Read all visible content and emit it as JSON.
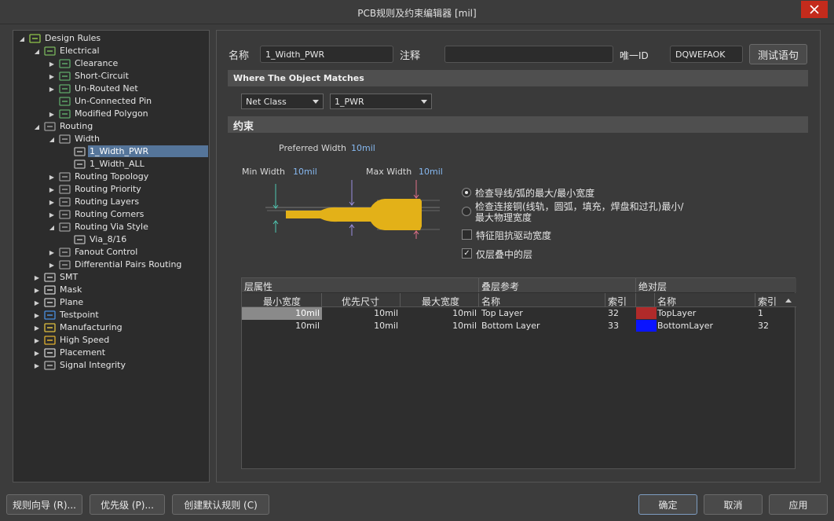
{
  "window": {
    "title": "PCB规则及约束编辑器 [mil]"
  },
  "tree": {
    "items": [
      {
        "label": "Design Rules",
        "icon": "design-rules-icon",
        "expand": "open"
      },
      {
        "label": "Electrical",
        "icon": "electrical-icon",
        "expand": "open"
      },
      {
        "label": "Clearance",
        "icon": "rule-icon",
        "expand": "closed"
      },
      {
        "label": "Short-Circuit",
        "icon": "rule-icon",
        "expand": "closed"
      },
      {
        "label": "Un-Routed Net",
        "icon": "rule-icon",
        "expand": "closed"
      },
      {
        "label": "Un-Connected Pin",
        "icon": "rule-icon",
        "expand": "none"
      },
      {
        "label": "Modified Polygon",
        "icon": "rule-icon",
        "expand": "closed"
      },
      {
        "label": "Routing",
        "icon": "routing-icon",
        "expand": "open"
      },
      {
        "label": "Width",
        "icon": "width-icon",
        "expand": "open"
      },
      {
        "label": "1_Width_PWR",
        "icon": "width-rule-icon",
        "expand": "none"
      },
      {
        "label": "1_Width_ALL",
        "icon": "width-rule-icon",
        "expand": "none"
      },
      {
        "label": "Routing Topology",
        "icon": "routing-icon",
        "expand": "closed"
      },
      {
        "label": "Routing Priority",
        "icon": "routing-icon",
        "expand": "closed"
      },
      {
        "label": "Routing Layers",
        "icon": "routing-icon",
        "expand": "closed"
      },
      {
        "label": "Routing Corners",
        "icon": "routing-icon",
        "expand": "closed"
      },
      {
        "label": "Routing Via Style",
        "icon": "routing-icon",
        "expand": "open"
      },
      {
        "label": "Via_8/16",
        "icon": "via-rule-icon",
        "expand": "none"
      },
      {
        "label": "Fanout Control",
        "icon": "routing-icon",
        "expand": "closed"
      },
      {
        "label": "Differential Pairs Routing",
        "icon": "routing-icon",
        "expand": "closed"
      },
      {
        "label": "SMT",
        "icon": "smt-icon",
        "expand": "closed"
      },
      {
        "label": "Mask",
        "icon": "mask-icon",
        "expand": "closed"
      },
      {
        "label": "Plane",
        "icon": "plane-icon",
        "expand": "closed"
      },
      {
        "label": "Testpoint",
        "icon": "testpoint-icon",
        "expand": "closed"
      },
      {
        "label": "Manufacturing",
        "icon": "manufacturing-icon",
        "expand": "closed"
      },
      {
        "label": "High Speed",
        "icon": "high-speed-icon",
        "expand": "closed"
      },
      {
        "label": "Placement",
        "icon": "placement-icon",
        "expand": "closed"
      },
      {
        "label": "Signal Integrity",
        "icon": "signal-integrity-icon",
        "expand": "closed"
      }
    ]
  },
  "rule": {
    "name_label": "名称",
    "name_value": "1_Width_PWR",
    "comment_label": "注释",
    "comment_value": "",
    "uid_label": "唯一ID",
    "uid_value": "DQWEFAOK",
    "test_button": "测试语句"
  },
  "match": {
    "section_title": "Where The Object Matches",
    "type_value": "Net Class",
    "class_value": "1_PWR"
  },
  "constraints": {
    "section_title": "约束",
    "preferred_label": "Preferred Width",
    "preferred_value": "10mil",
    "min_label": "Min Width",
    "min_value": "10mil",
    "max_label": "Max Width",
    "max_value": "10mil",
    "options": {
      "radio1": "检查导线/弧的最大/最小宽度",
      "radio2": "检查连接铜(线轨，圆弧，填充，焊盘和过孔)最小/最大物理宽度",
      "check1": "特征阻抗驱动宽度",
      "check2": "仅层叠中的层"
    },
    "trace_color": "#e3b118"
  },
  "grid": {
    "groups": [
      "层属性",
      "叠层参考",
      "绝对层"
    ],
    "headers": [
      "最小宽度",
      "优先尺寸",
      "最大宽度",
      "名称",
      "索引",
      "名称",
      "索引"
    ],
    "rows": [
      {
        "min": "10mil",
        "pref": "10mil",
        "max": "10mil",
        "stack_name": "Top Layer",
        "stack_index": "32",
        "abs_name": "TopLayer",
        "abs_index": "1",
        "color": "#b02a2a"
      },
      {
        "min": "10mil",
        "pref": "10mil",
        "max": "10mil",
        "stack_name": "Bottom Layer",
        "stack_index": "33",
        "abs_name": "BottomLayer",
        "abs_index": "32",
        "color": "#0a14ff"
      }
    ]
  },
  "footer": {
    "wizard": "规则向导 (R)...",
    "priority": "优先级 (P)...",
    "create_default": "创建默认规则 (C)",
    "ok": "确定",
    "cancel": "取消",
    "apply": "应用"
  }
}
